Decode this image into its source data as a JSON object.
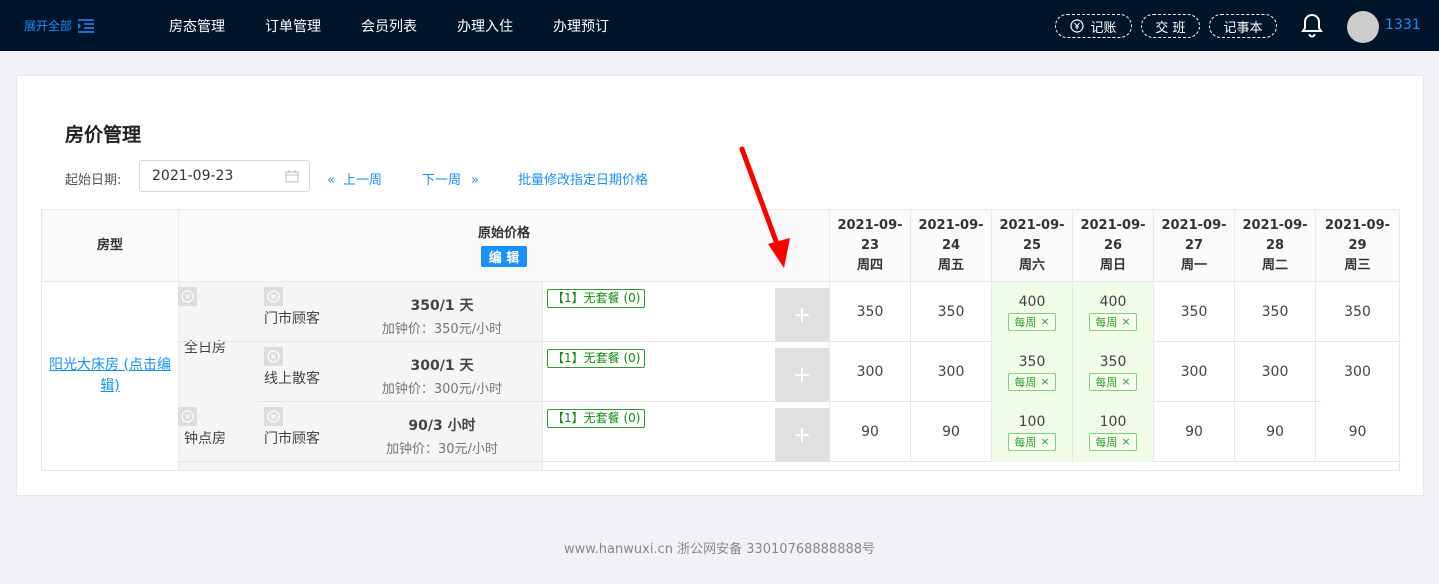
{
  "topbar": {
    "expand_label": "展开全部",
    "nav": [
      "房态管理",
      "订单管理",
      "会员列表",
      "办理入住",
      "办理预订"
    ],
    "buttons": {
      "account": "记账",
      "shift": "交 班",
      "notes": "记事本"
    },
    "user_id": "1331"
  },
  "page": {
    "title": "房价管理",
    "start_date_label": "起始日期:",
    "start_date_value": "2021-09-23",
    "prev_week": "上一周",
    "next_week": "下一周",
    "batch_edit": "批量修改指定日期价格"
  },
  "table": {
    "header_room_type": "房型",
    "header_original_price": "原始价格",
    "edit_label": "编 辑",
    "dates": [
      {
        "date_a": "2021-09-",
        "date_b": "23",
        "weekday": "周四"
      },
      {
        "date_a": "2021-09-",
        "date_b": "24",
        "weekday": "周五"
      },
      {
        "date_a": "2021-09-",
        "date_b": "25",
        "weekday": "周六"
      },
      {
        "date_a": "2021-09-",
        "date_b": "26",
        "weekday": "周日"
      },
      {
        "date_a": "2021-09-",
        "date_b": "27",
        "weekday": "周一"
      },
      {
        "date_a": "2021-09-",
        "date_b": "28",
        "weekday": "周二"
      },
      {
        "date_a": "2021-09-",
        "date_b": "29",
        "weekday": "周三"
      }
    ],
    "room_name": "阳光大床房 (点击编辑)",
    "room_name_line1": "阳光大床房 (点击编",
    "room_name_line2": "辑)",
    "rate_groups": [
      "全日房",
      "钟点房"
    ],
    "weekly_tag": "每周",
    "rows": [
      {
        "customer": "门市顾客",
        "price": "350/1 天",
        "extra": "加钟价：350元/小时",
        "package": "【1】无套餐 (0)",
        "values": [
          "350",
          "350",
          "400",
          "400",
          "350",
          "350",
          "350"
        ]
      },
      {
        "customer": "线上散客",
        "price": "300/1 天",
        "extra": "加钟价：300元/小时",
        "package": "【1】无套餐 (0)",
        "values": [
          "300",
          "300",
          "350",
          "350",
          "300",
          "300",
          "300"
        ]
      },
      {
        "customer": "门市顾客",
        "price": "90/3 小时",
        "extra": "加钟价：30元/小时",
        "package": "【1】无套餐 (0)",
        "values": [
          "90",
          "90",
          "100",
          "100",
          "90",
          "90",
          "90"
        ]
      }
    ]
  },
  "footer": "www.hanwuxi.cn 浙公网安备 33010768888888号",
  "colors": {
    "accent": "#1890ff",
    "topbar": "#001529",
    "weekend_bg": "#f0fbe8",
    "tag_green": "#2a9d2a"
  }
}
